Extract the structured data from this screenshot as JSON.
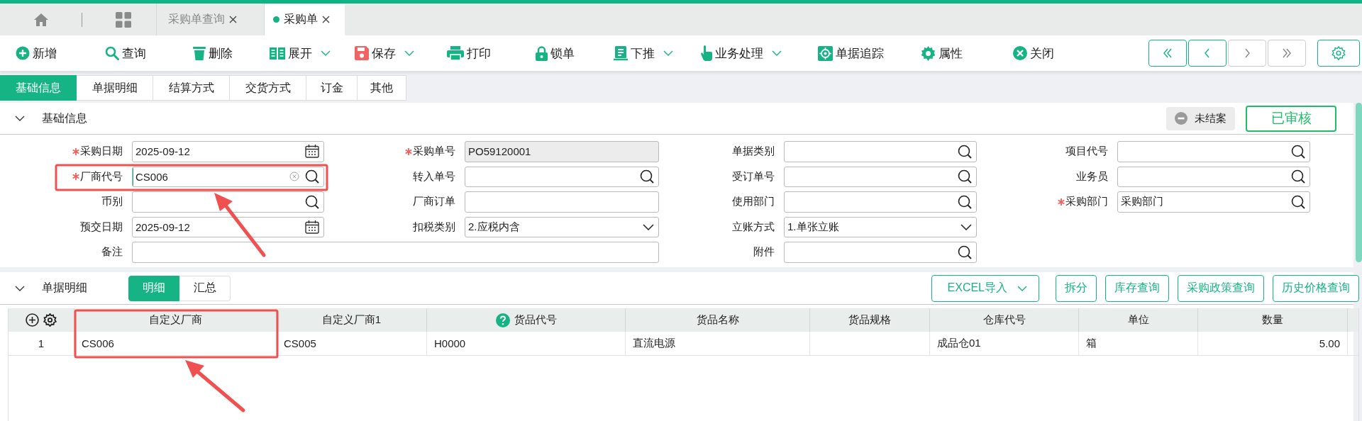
{
  "document_tabs": [
    {
      "label": "采购单查询",
      "selected": false
    },
    {
      "label": "采购单",
      "selected": true
    }
  ],
  "toolbar": [
    {
      "label": "新增",
      "dropdown": false
    },
    {
      "label": "查询",
      "dropdown": false
    },
    {
      "label": "删除",
      "dropdown": false
    },
    {
      "label": "展开",
      "dropdown": true
    },
    {
      "label": "保存",
      "dropdown": true
    },
    {
      "label": "打印",
      "dropdown": false
    },
    {
      "label": "锁单",
      "dropdown": false
    },
    {
      "label": "下推",
      "dropdown": true
    },
    {
      "label": "业务处理",
      "dropdown": true
    },
    {
      "label": "单据追踪",
      "dropdown": false
    },
    {
      "label": "属性",
      "dropdown": false
    },
    {
      "label": "关闭",
      "dropdown": false
    }
  ],
  "record_nav": [
    {
      "disabled": false
    },
    {
      "disabled": false
    },
    {
      "disabled": true
    },
    {
      "disabled": true
    }
  ],
  "section_tabs": [
    {
      "label": "基础信息",
      "selected": true
    },
    {
      "label": "单据明细",
      "selected": false
    },
    {
      "label": "结算方式",
      "selected": false
    },
    {
      "label": "交货方式",
      "selected": false
    },
    {
      "label": "订金",
      "selected": false
    },
    {
      "label": "其他",
      "selected": false
    }
  ],
  "basic_info": {
    "title": "基础信息",
    "expanded": true,
    "close_status": "未结案",
    "audit_status": "已审核",
    "rows": [
      [
        {
          "label": "采购日期",
          "required": true,
          "kind": "date",
          "value": "2025-09-12",
          "focused": false
        },
        {
          "label": "采购单号",
          "required": true,
          "kind": "readonly",
          "value": "PO59120001",
          "focused": false
        },
        {
          "label": "单据类别",
          "required": false,
          "kind": "lookup",
          "focused": false
        },
        {
          "label": "项目代号",
          "required": false,
          "kind": "lookup",
          "focused": false
        }
      ],
      [
        {
          "label": "厂商代号",
          "required": true,
          "kind": "lookup",
          "value": "CS006",
          "focused": true
        },
        {
          "label": "转入单号",
          "required": false,
          "kind": "lookup",
          "focused": false
        },
        {
          "label": "受订单号",
          "required": false,
          "kind": "lookup",
          "focused": false
        },
        {
          "label": "业务员",
          "required": false,
          "kind": "lookup",
          "focused": false
        }
      ],
      [
        {
          "label": "币别",
          "required": false,
          "kind": "lookup",
          "focused": false
        },
        {
          "label": "厂商订单",
          "required": false,
          "kind": "text",
          "focused": false
        },
        {
          "label": "使用部门",
          "required": false,
          "kind": "lookup",
          "focused": false
        },
        {
          "label": "采购部门",
          "required": true,
          "kind": "lookup",
          "value": "采购部门",
          "focused": false
        }
      ],
      [
        {
          "label": "预交日期",
          "required": false,
          "kind": "date",
          "value": "2025-09-12",
          "focused": false
        },
        {
          "label": "扣税类别",
          "required": false,
          "kind": "select",
          "value": "2.应税内含",
          "focused": false
        },
        {
          "label": "立账方式",
          "required": false,
          "kind": "select",
          "value": "1.单张立账",
          "focused": false
        }
      ],
      [
        {
          "label": "备注",
          "required": false,
          "kind": "memo",
          "focused": false
        },
        "",
        {
          "label": "附件",
          "required": false,
          "kind": "lookup",
          "focused": false
        }
      ]
    ]
  },
  "detail": {
    "title": "单据明细",
    "expanded": true,
    "views": [
      {
        "label": "明细",
        "selected": true
      },
      {
        "label": "汇总",
        "selected": false
      }
    ],
    "actions": [
      {
        "label": "EXCEL导入",
        "dropdown": true
      },
      {
        "label": "拆分",
        "dropdown": false
      },
      {
        "label": "库存查询",
        "dropdown": false
      },
      {
        "label": "采购政策查询",
        "dropdown": false
      },
      {
        "label": "历史价格查询",
        "dropdown": false
      }
    ],
    "columns": [
      {
        "kind": "tools"
      },
      {
        "label": "自定义厂商",
        "help": false
      },
      {
        "label": "自定义厂商1",
        "help": false
      },
      {
        "label": "货品代号",
        "help": true
      },
      {
        "label": "货品名称",
        "help": false
      },
      {
        "label": "货品规格",
        "help": false
      },
      {
        "label": "仓库代号",
        "help": false
      },
      {
        "label": "单位",
        "help": false
      },
      {
        "label": "数量",
        "help": false
      }
    ],
    "rows": [
      [
        "1",
        "CS006",
        "CS005",
        "H0000",
        "直流电源",
        "",
        "成品仓01",
        "箱",
        "5.00"
      ]
    ]
  }
}
